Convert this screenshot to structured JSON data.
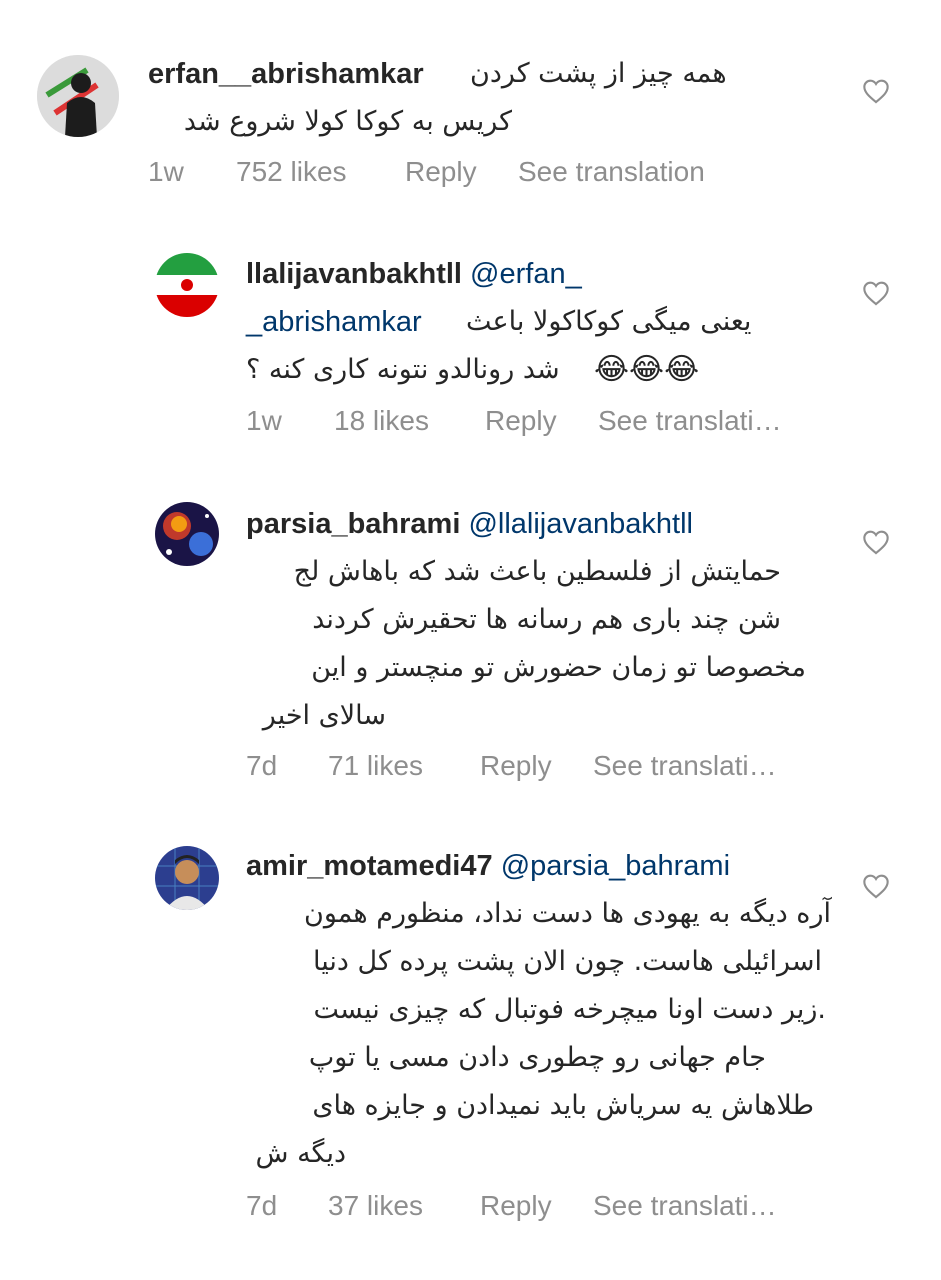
{
  "comments": [
    {
      "username": "erfan__abrishamkar",
      "mention": "",
      "lines": [
        "همه چیز از پشت کردن",
        "کریس به کوکا کولا شروع شد"
      ],
      "time": "1w",
      "likes": "752 likes",
      "reply": "Reply",
      "translation": "See translation",
      "avatar_icon": "person-silhouette-avatar",
      "is_reply": false
    },
    {
      "username": "llalijavanbakhtll",
      "mention": "@erfan_ _abrishamkar",
      "mention_part1": "@erfan_",
      "mention_part2": "_abrishamkar",
      "lines": [
        "یعنی میگی کوکاکولا باعث",
        "شد رونالدو نتونه کاری کنه ؟"
      ],
      "emoji": "😂😂😂",
      "time": "1w",
      "likes": "18 likes",
      "reply": "Reply",
      "translation": "See translati…",
      "avatar_icon": "iran-flag-avatar",
      "is_reply": true
    },
    {
      "username": "parsia_bahrami",
      "mention": "@llalijavanbakhtll",
      "lines": [
        "حمایتش از فلسطین باعث شد که باهاش لج",
        "شن چند باری هم رسانه ها تحقیرش کردند",
        "مخصوصا تو زمان حضورش تو منچستر و این",
        "سالای اخیر"
      ],
      "time": "7d",
      "likes": "71 likes",
      "reply": "Reply",
      "translation": "See translati…",
      "avatar_icon": "galaxy-avatar",
      "is_reply": true
    },
    {
      "username": "amir_motamedi47",
      "mention": "@parsia_bahrami",
      "lines": [
        "آره دیگه به یهودی ها دست نداد، منظورم همون",
        "اسرائیلی هاست. چون الان پشت پرده کل دنیا",
        "زیر دست اونا میچرخه فوتبال که چیزی نیست.",
        "جام جهانی رو چطوری دادن مسی یا توپ",
        "طلاهاش یه سریاش باید نمیدادن و جایزه های",
        "دیگه ش"
      ],
      "time": "7d",
      "likes": "37 likes",
      "reply": "Reply",
      "translation": "See translati…",
      "avatar_icon": "person-photo-avatar",
      "is_reply": true
    }
  ],
  "colors": {
    "text": "#262626",
    "meta": "#8e8e8e",
    "mention": "#00376b",
    "background": "#ffffff"
  },
  "like_icon": "heart-outline-icon"
}
